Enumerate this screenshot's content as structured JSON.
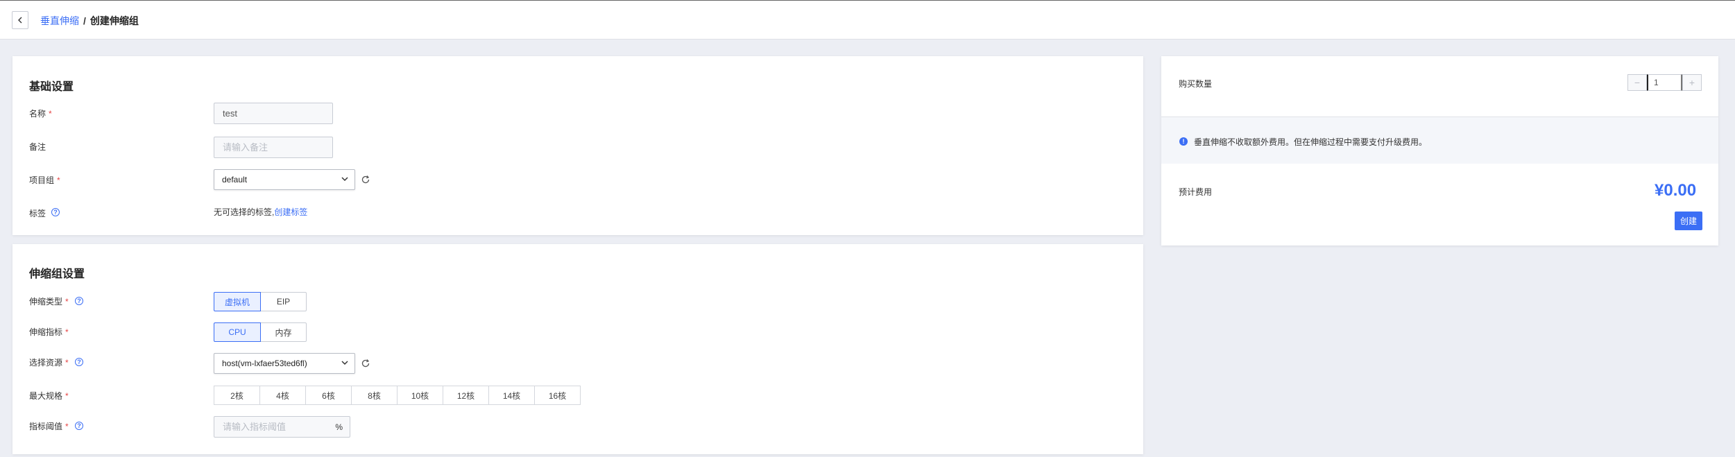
{
  "breadcrumb": {
    "parent": "垂直伸缩",
    "separator": "/",
    "current": "创建伸缩组"
  },
  "basic": {
    "title": "基础设置",
    "name_label": "名称",
    "name_value": "test",
    "remark_label": "备注",
    "remark_placeholder": "请输入备注",
    "project_label": "项目组",
    "project_value": "default",
    "tag_label": "标签",
    "tag_text": "无可选择的标签,",
    "tag_link": "创建标签"
  },
  "scaling": {
    "title": "伸缩组设置",
    "type_label": "伸缩类型",
    "type_options": [
      "虚拟机",
      "EIP"
    ],
    "metric_label": "伸缩指标",
    "metric_options": [
      "CPU",
      "内存"
    ],
    "resource_label": "选择资源",
    "resource_value": "host(vm-lxfaer53ted6fl)",
    "max_label": "最大规格",
    "max_options": [
      "2核",
      "4核",
      "6核",
      "8核",
      "10核",
      "12核",
      "14核",
      "16核"
    ],
    "threshold_label": "指标阈值",
    "threshold_placeholder": "请输入指标阈值",
    "threshold_unit": "%"
  },
  "summary": {
    "qty_label": "购买数量",
    "qty_value": "1",
    "minus": "−",
    "plus": "+",
    "notice": "垂直伸缩不收取额外费用。但在伸缩过程中需要支付升级费用。",
    "cost_label": "预计费用",
    "cost_value": "¥0.00",
    "create_label": "创建"
  },
  "required_mark": "*",
  "help_glyph": "?",
  "info_glyph": "!",
  "colors": {
    "accent": "#3b6ef5",
    "required": "#e54545",
    "background": "#eceef4"
  }
}
